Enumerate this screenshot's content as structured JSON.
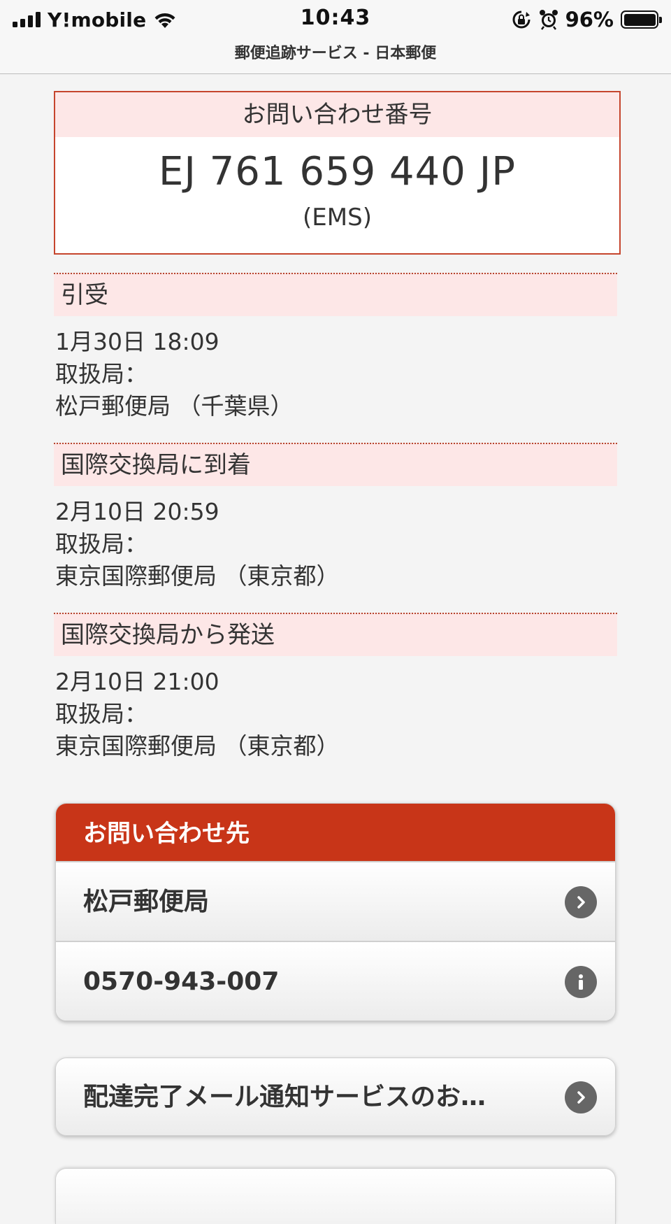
{
  "status_bar": {
    "carrier": "Y!mobile",
    "time": "10:43",
    "battery": "96%"
  },
  "browser": {
    "page_title": "郵便追跡サービス - 日本郵便"
  },
  "tracking": {
    "header": "お問い合わせ番号",
    "number": "EJ 761 659 440 JP",
    "type": "(EMS)"
  },
  "events": [
    {
      "status": "引受",
      "datetime": "1月30日 18:09",
      "office_label": "取扱局：",
      "office": "松戸郵便局 （千葉県）"
    },
    {
      "status": "国際交換局に到着",
      "datetime": "2月10日 20:59",
      "office_label": "取扱局：",
      "office": "東京国際郵便局 （東京都）"
    },
    {
      "status": "国際交換局から発送",
      "datetime": "2月10日 21:00",
      "office_label": "取扱局：",
      "office": "東京国際郵便局 （東京都）"
    }
  ],
  "contact": {
    "header": "お問い合わせ先",
    "office": "松戸郵便局",
    "phone": "0570-943-007"
  },
  "mail_notice": {
    "label": "配達完了メール通知サービスのお…"
  },
  "colors": {
    "accent": "#c83518",
    "border": "#c5452d",
    "highlight": "#fde7e7"
  }
}
